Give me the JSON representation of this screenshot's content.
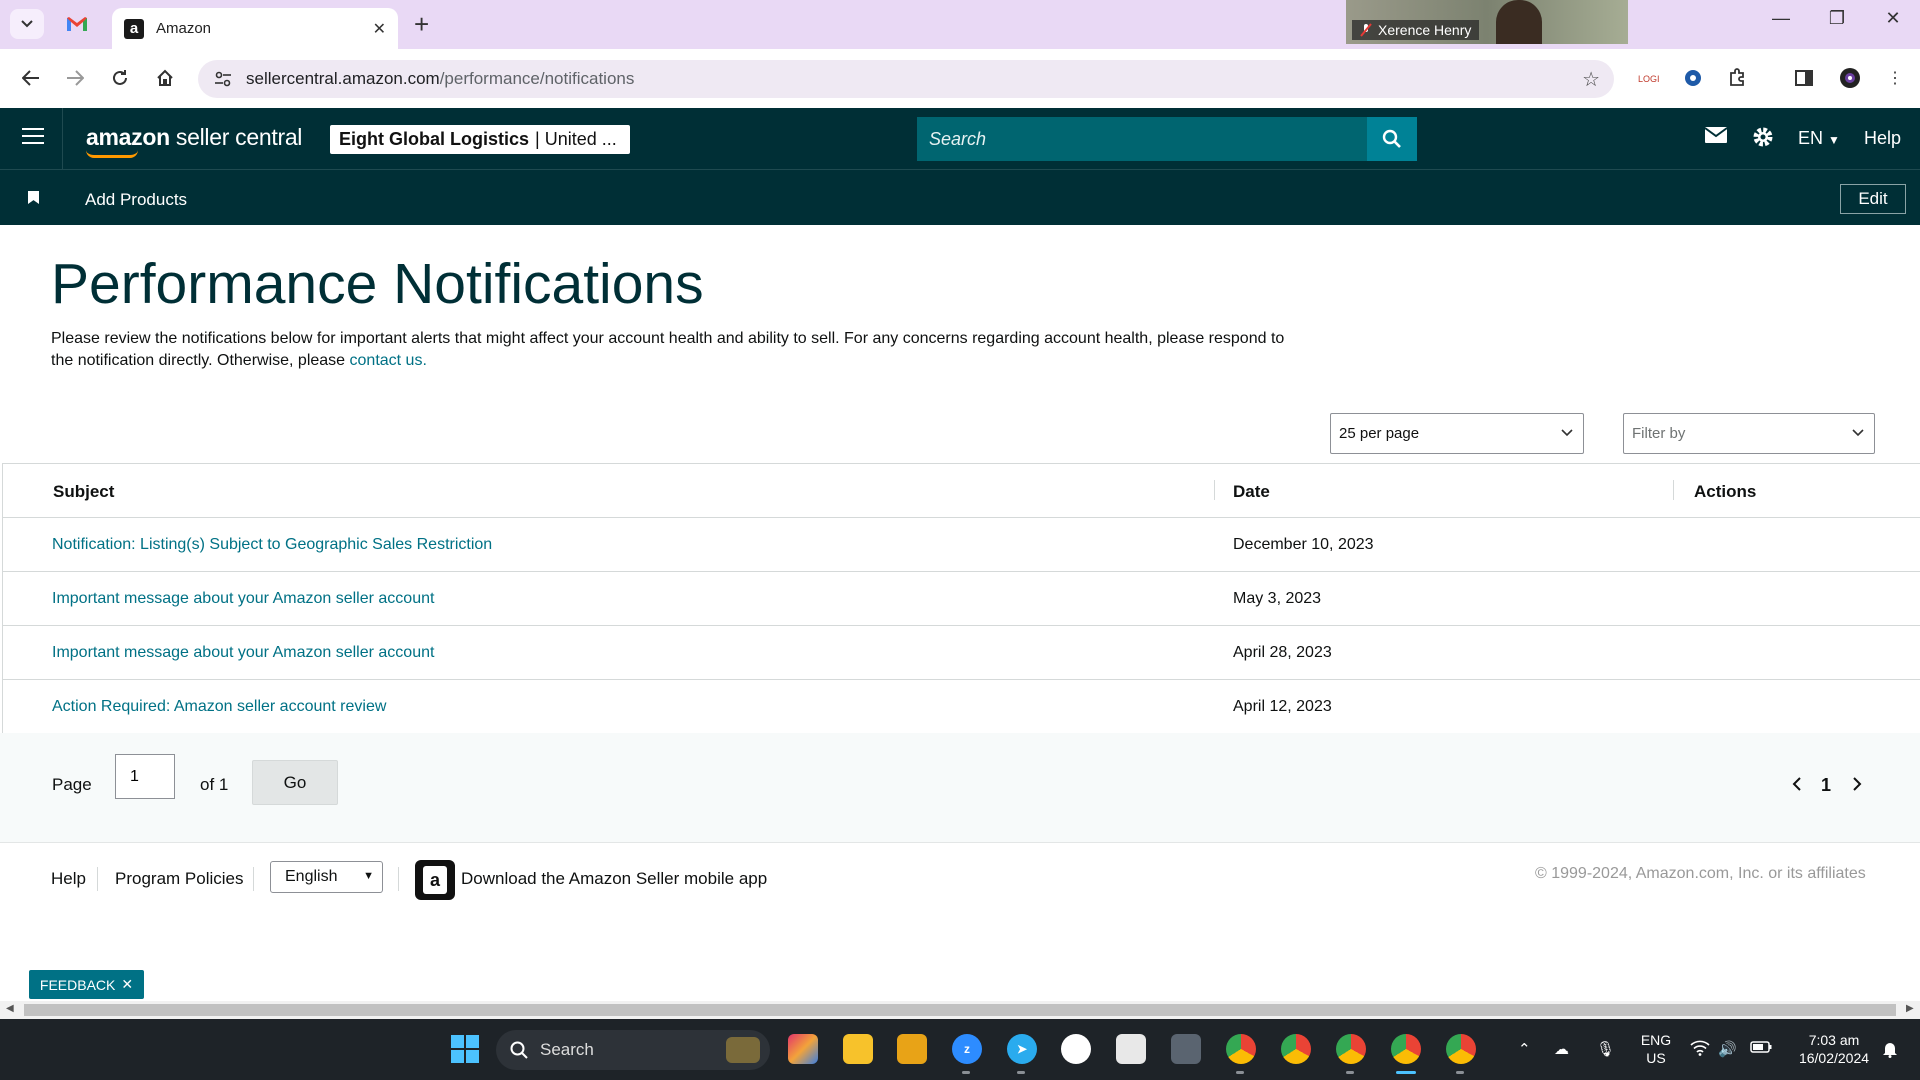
{
  "browser": {
    "tab_title": "Amazon",
    "url_host": "sellercentral.amazon.com",
    "url_path": "/performance/notifications",
    "video_participant": "Xerence Henry"
  },
  "header": {
    "logo_bold": "amazon",
    "logo_rest": " seller central",
    "account_name": "Eight Global Logistics",
    "account_region": "| United ...",
    "search_placeholder": "Search",
    "language": "EN",
    "help": "Help"
  },
  "bookmarks": {
    "add_products": "Add Products",
    "edit": "Edit"
  },
  "page": {
    "title": "Performance Notifications",
    "intro": "Please review the notifications below for important alerts that might affect your account health and ability to sell. For any concerns regarding account health, please respond to the notification directly. Otherwise, please ",
    "contact_link": "contact us."
  },
  "filters": {
    "per_page": "25 per page",
    "filter_placeholder": "Filter by"
  },
  "table": {
    "headers": {
      "subject": "Subject",
      "date": "Date",
      "actions": "Actions"
    },
    "rows": [
      {
        "subject": "Notification: Listing(s) Subject to Geographic Sales Restriction",
        "date": "December 10, 2023"
      },
      {
        "subject": "Important message about your Amazon seller account",
        "date": "May 3, 2023"
      },
      {
        "subject": "Important message about your Amazon seller account",
        "date": "April 28, 2023"
      },
      {
        "subject": "Action Required: Amazon seller account review",
        "date": "April 12, 2023"
      }
    ]
  },
  "pager": {
    "page_label": "Page",
    "page_value": "1",
    "of_label": "of 1",
    "go": "Go",
    "current": "1"
  },
  "footer": {
    "help": "Help",
    "program_policies": "Program Policies",
    "language": "English",
    "app_download": "Download the Amazon Seller mobile app",
    "copyright": "© 1999-2024, Amazon.com, Inc. or its affiliates"
  },
  "feedback": "FEEDBACK",
  "taskbar": {
    "search": "Search",
    "lang_top": "ENG",
    "lang_bottom": "US",
    "time": "7:03 am",
    "date": "16/02/2024"
  }
}
